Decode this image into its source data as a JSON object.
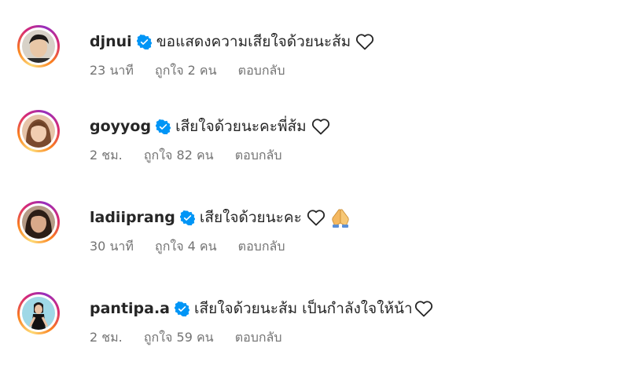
{
  "comments": [
    {
      "username": "djnui",
      "verified": true,
      "text": "ขอแสดงความเสียใจด้วยนะส้ม",
      "emoji": [
        "heart-outline"
      ],
      "time": "23 นาที",
      "likes": "ถูกใจ 2 คน",
      "reply": "ตอบกลับ"
    },
    {
      "username": "goyyog",
      "verified": true,
      "text": "เสียใจด้วยนะคะพี่ส้ม",
      "emoji": [
        "heart-outline"
      ],
      "time": "2 ชม.",
      "likes": "ถูกใจ 82 คน",
      "reply": "ตอบกลับ"
    },
    {
      "username": "ladiiprang",
      "verified": true,
      "text": "เสียใจด้วยนะคะ",
      "emoji": [
        "heart-outline",
        "folded-hands"
      ],
      "time": "30 นาที",
      "likes": "ถูกใจ 4 คน",
      "reply": "ตอบกลับ"
    },
    {
      "username": "pantipa.a",
      "verified": true,
      "text": "เสียใจด้วยนะส้ม เป็นกำลังใจให้น้า",
      "emoji": [
        "heart-outline"
      ],
      "time": "2 ชม.",
      "likes": "ถูกใจ 59 คน",
      "reply": "ตอบกลับ"
    }
  ],
  "colors": {
    "text": "#262626",
    "meta": "#737373",
    "verified_blue": "#0095f6"
  }
}
